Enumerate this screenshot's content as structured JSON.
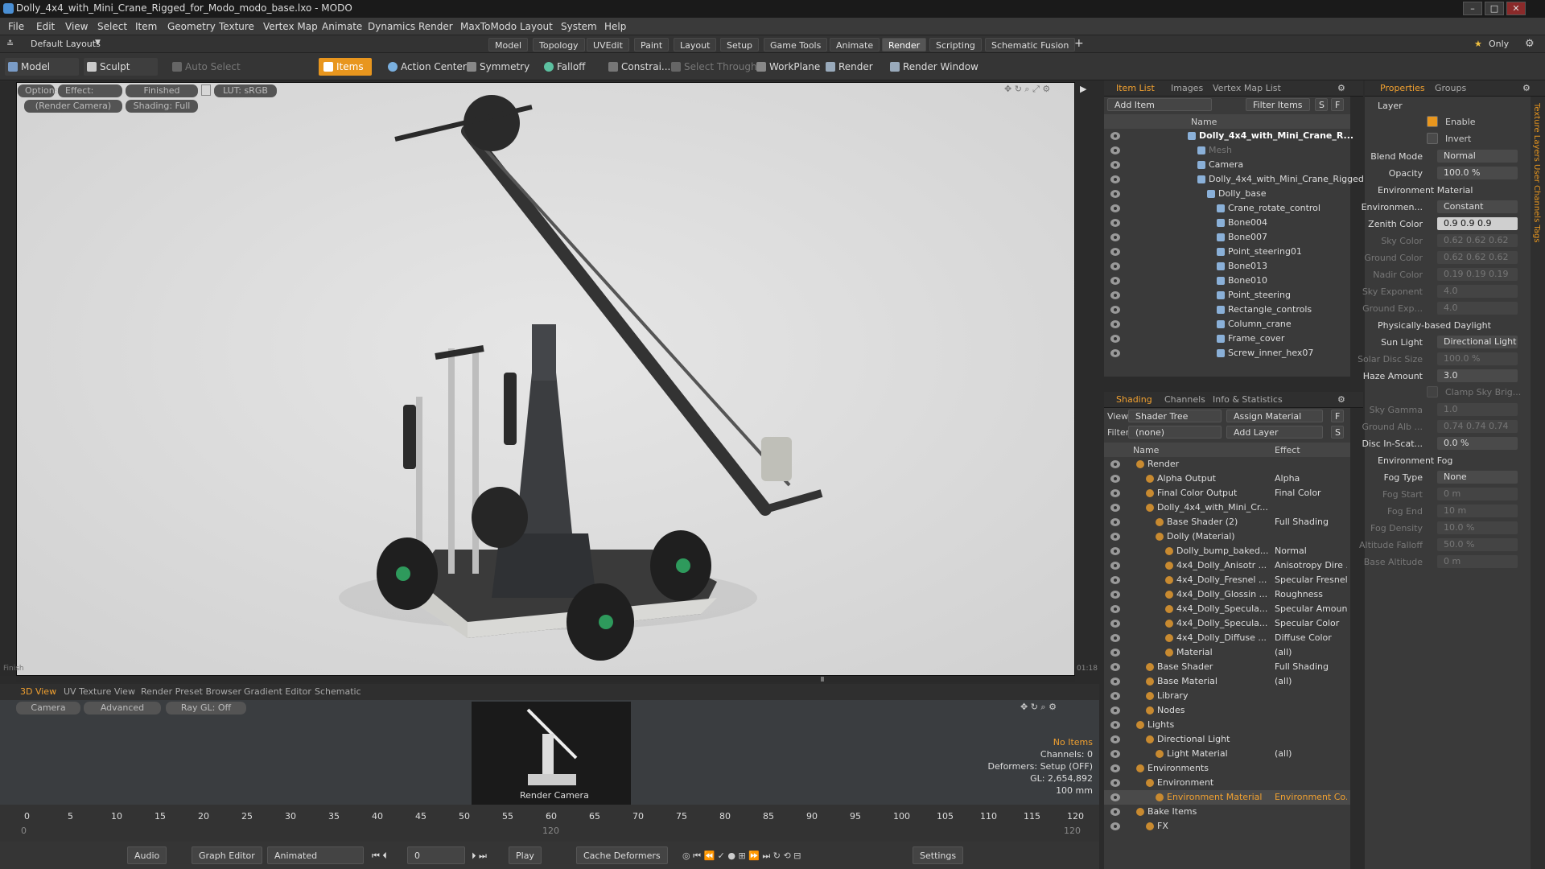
{
  "window": {
    "title": "Dolly_4x4_with_Mini_Crane_Rigged_for_Modo_modo_base.lxo - MODO",
    "min": "–",
    "max": "□",
    "close": "✕"
  },
  "menu": [
    "File",
    "Edit",
    "View",
    "Select",
    "Item",
    "Geometry",
    "Texture",
    "Vertex Map",
    "Animate",
    "Dynamics",
    "Render",
    "MaxToModo",
    "Layout",
    "System",
    "Help"
  ],
  "layoutbar": {
    "layouts": "Default Layouts",
    "tabs": [
      "Model",
      "Topology",
      "UVEdit",
      "Paint",
      "Layout",
      "Setup",
      "Game Tools",
      "Animate",
      "Render",
      "Scripting",
      "Schematic Fusion"
    ],
    "selected": "Render",
    "plus": "+",
    "only": "Only"
  },
  "toolbar": {
    "model": "Model",
    "sculpt": "Sculpt",
    "auto_select": "Auto Select",
    "items": "Items",
    "action_center": "Action Center",
    "symmetry": "Symmetry",
    "falloff": "Falloff",
    "constrain": "Constrai...",
    "select_through": "Select Through",
    "workplane": "WorkPlane",
    "render": "Render",
    "render_window": "Render Window"
  },
  "viewport": {
    "options": "Options",
    "effect": "Effect: (Shadi...",
    "finished": "Finished",
    "lut": "LUT: sRGB",
    "render_camera": "(Render Camera)",
    "shading": "Shading: Full",
    "finish_label": "Finish",
    "time_label": "01:18"
  },
  "item_list": {
    "tabs": [
      "Item List",
      "Images",
      "Vertex Map List"
    ],
    "add_item": "Add Item",
    "filter_items": "Filter Items",
    "s": "S",
    "f": "F",
    "name_col": "Name",
    "rows": [
      {
        "label": "Dolly_4x4_with_Mini_Crane_R...",
        "indent": 0,
        "bold": true,
        "dim": false
      },
      {
        "label": "Mesh",
        "indent": 1,
        "bold": false,
        "dim": true
      },
      {
        "label": "Camera",
        "indent": 1,
        "bold": false,
        "dim": false
      },
      {
        "label": "Dolly_4x4_with_Mini_Crane_Rigged",
        "indent": 1,
        "bold": false,
        "dim": false
      },
      {
        "label": "Dolly_base",
        "indent": 2,
        "bold": false,
        "dim": false
      },
      {
        "label": "Crane_rotate_control",
        "indent": 3,
        "bold": false,
        "dim": false
      },
      {
        "label": "Bone004",
        "indent": 3,
        "bold": false,
        "dim": false
      },
      {
        "label": "Bone007",
        "indent": 3,
        "bold": false,
        "dim": false
      },
      {
        "label": "Point_steering01",
        "indent": 3,
        "bold": false,
        "dim": false
      },
      {
        "label": "Bone013",
        "indent": 3,
        "bold": false,
        "dim": false
      },
      {
        "label": "Bone010",
        "indent": 3,
        "bold": false,
        "dim": false
      },
      {
        "label": "Point_steering",
        "indent": 3,
        "bold": false,
        "dim": false
      },
      {
        "label": "Rectangle_controls",
        "indent": 3,
        "bold": false,
        "dim": false
      },
      {
        "label": "Column_crane",
        "indent": 3,
        "bold": false,
        "dim": false
      },
      {
        "label": "Frame_cover",
        "indent": 3,
        "bold": false,
        "dim": false
      },
      {
        "label": "Screw_inner_hex07",
        "indent": 3,
        "bold": false,
        "dim": false
      }
    ]
  },
  "shading": {
    "tabs": [
      "Shading",
      "Channels",
      "Info & Statistics"
    ],
    "view_label": "View",
    "view_value": "Shader Tree",
    "assign_material": "Assign Material",
    "filter_label": "Filter",
    "filter_value": "(none)",
    "add_layer": "Add Layer",
    "name_col": "Name",
    "effect_col": "Effect",
    "f": "F",
    "s": "S",
    "rows": [
      {
        "label": "Render",
        "effect": "",
        "indent": 0,
        "sel": false
      },
      {
        "label": "Alpha Output",
        "effect": "Alpha",
        "indent": 1,
        "sel": false
      },
      {
        "label": "Final Color Output",
        "effect": "Final Color",
        "indent": 1,
        "sel": false
      },
      {
        "label": "Dolly_4x4_with_Mini_Cr...",
        "effect": "",
        "indent": 1,
        "sel": false
      },
      {
        "label": "Base Shader (2)",
        "effect": "Full Shading",
        "indent": 2,
        "sel": false
      },
      {
        "label": "Dolly (Material)",
        "effect": "",
        "indent": 2,
        "sel": false
      },
      {
        "label": "Dolly_bump_baked...",
        "effect": "Normal",
        "indent": 3,
        "sel": false
      },
      {
        "label": "4x4_Dolly_Anisotr ...",
        "effect": "Anisotropy Dire ...",
        "indent": 3,
        "sel": false
      },
      {
        "label": "4x4_Dolly_Fresnel ...",
        "effect": "Specular Fresnel",
        "indent": 3,
        "sel": false
      },
      {
        "label": "4x4_Dolly_Glossin ...",
        "effect": "Roughness",
        "indent": 3,
        "sel": false
      },
      {
        "label": "4x4_Dolly_Specula...",
        "effect": "Specular Amount",
        "indent": 3,
        "sel": false
      },
      {
        "label": "4x4_Dolly_Specula...",
        "effect": "Specular Color",
        "indent": 3,
        "sel": false
      },
      {
        "label": "4x4_Dolly_Diffuse ...",
        "effect": "Diffuse Color",
        "indent": 3,
        "sel": false
      },
      {
        "label": "Material",
        "effect": "(all)",
        "indent": 3,
        "sel": false
      },
      {
        "label": "Base Shader",
        "effect": "Full Shading",
        "indent": 1,
        "sel": false
      },
      {
        "label": "Base Material",
        "effect": "(all)",
        "indent": 1,
        "sel": false
      },
      {
        "label": "Library",
        "effect": "",
        "indent": 1,
        "sel": false
      },
      {
        "label": "Nodes",
        "effect": "",
        "indent": 1,
        "sel": false
      },
      {
        "label": "Lights",
        "effect": "",
        "indent": 0,
        "sel": false
      },
      {
        "label": "Directional Light",
        "effect": "",
        "indent": 1,
        "sel": false
      },
      {
        "label": "Light Material",
        "effect": "(all)",
        "indent": 2,
        "sel": false
      },
      {
        "label": "Environments",
        "effect": "",
        "indent": 0,
        "sel": false
      },
      {
        "label": "Environment",
        "effect": "",
        "indent": 1,
        "sel": false
      },
      {
        "label": "Environment Material",
        "effect": "Environment Co...",
        "indent": 2,
        "sel": true
      },
      {
        "label": "Bake Items",
        "effect": "",
        "indent": 0,
        "sel": false
      },
      {
        "label": "FX",
        "effect": "",
        "indent": 1,
        "sel": false
      }
    ]
  },
  "properties": {
    "tabs": [
      "Properties",
      "Groups"
    ],
    "side_tabs": "Texture Layers  User Channels  Tags",
    "layer": "Layer",
    "enable": "Enable",
    "invert": "Invert",
    "blend_mode": "Blend Mode",
    "blend_mode_value": "Normal",
    "opacity": "Opacity",
    "opacity_value": "100.0 %",
    "env_material": "Environment Material",
    "environment": "Environmen...",
    "environment_value": "Constant",
    "zenith": "Zenith Color",
    "zenith_value": "0.9   0.9   0.9",
    "sky": "Sky Color",
    "sky_value": "0.62  0.62  0.62",
    "ground": "Ground Color",
    "ground_value": "0.62  0.62  0.62",
    "nadir": "Nadir Color",
    "nadir_value": "0.19  0.19  0.19",
    "sky_exp": "Sky Exponent",
    "sky_exp_value": "4.0",
    "ground_exp": "Ground Exp...",
    "ground_exp_value": "4.0",
    "pbd": "Physically-based Daylight",
    "sun_light": "Sun Light",
    "sun_light_value": "Directional Light",
    "solar": "Solar Disc Size",
    "solar_value": "100.0 %",
    "haze": "Haze Amount",
    "haze_value": "3.0",
    "clamp": "Clamp Sky Brig...",
    "sky_gamma": "Sky Gamma",
    "sky_gamma_value": "1.0",
    "ground_alb": "Ground Alb ...",
    "ground_alb_value": "0.74  0.74  0.74",
    "disc": "Disc In-Scat...",
    "disc_value": "0.0 %",
    "env_fog": "Environment Fog",
    "fog_type": "Fog Type",
    "fog_type_value": "None",
    "fog_start": "Fog Start",
    "fog_start_value": "0 m",
    "fog_end": "Fog End",
    "fog_end_value": "10 m",
    "fog_density": "Fog Density",
    "fog_density_value": "10.0 %",
    "alt_falloff": "Altitude Falloff",
    "alt_falloff_value": "50.0 %",
    "base_alt": "Base Altitude",
    "base_alt_value": "0 m"
  },
  "bottom": {
    "tabs": [
      "3D View",
      "UV Texture View",
      "Render Preset Browser",
      "Gradient Editor",
      "Schematic"
    ],
    "camera": "Camera",
    "advanced": "Advanced",
    "raygl": "Ray GL: Off",
    "thumb_label": "Render Camera",
    "stats": [
      "No Items",
      "Channels: 0",
      "Deformers: Setup (OFF)",
      "GL: 2,654,892",
      "100 mm"
    ]
  },
  "timeline": {
    "ticks": [
      "0",
      "5",
      "10",
      "15",
      "20",
      "25",
      "30",
      "35",
      "40",
      "45",
      "50",
      "55",
      "60",
      "65",
      "70",
      "75",
      "80",
      "85",
      "90",
      "95",
      "100",
      "105",
      "110",
      "115",
      "120"
    ],
    "sub_left": "0",
    "sub_mid": "120",
    "sub_right": "120"
  },
  "transport": {
    "audio": "Audio",
    "graph_editor": "Graph Editor",
    "animated": "Animated",
    "frame": "0",
    "play": "Play",
    "cache_deformers": "Cache Deformers",
    "settings": "Settings"
  }
}
